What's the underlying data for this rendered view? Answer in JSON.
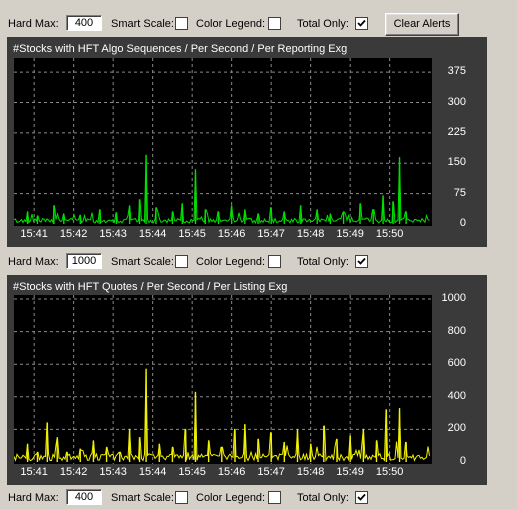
{
  "controls": {
    "hard_max_label": "Hard Max:",
    "smart_scale_label": "Smart Scale:",
    "color_legend_label": "Color Legend:",
    "total_only_label": "Total Only:",
    "clear_alerts_label": "Clear Alerts"
  },
  "rows": [
    {
      "hard_max": "400",
      "smart_scale": false,
      "color_legend": false,
      "total_only": true
    },
    {
      "hard_max": "1000",
      "smart_scale": false,
      "color_legend": false,
      "total_only": true
    },
    {
      "hard_max": "400",
      "smart_scale": false,
      "color_legend": false,
      "total_only": true
    }
  ],
  "chart_data": [
    {
      "type": "line",
      "title": "#Stocks with HFT Algo Sequences / Per Second / Per Reporting Exg",
      "color": "#00e000",
      "x_ticks": [
        "15:41",
        "15:42",
        "15:43",
        "15:44",
        "15:45",
        "15:46",
        "15:47",
        "15:48",
        "15:49",
        "15:50"
      ],
      "y_ticks": [
        0,
        75,
        150,
        225,
        300,
        375
      ],
      "ylim": [
        0,
        400
      ],
      "grid": true,
      "spikes": [
        {
          "t": "15:40:50",
          "v": 30
        },
        {
          "t": "15:41:05",
          "v": 20
        },
        {
          "t": "15:41:30",
          "v": 45
        },
        {
          "t": "15:41:45",
          "v": 25
        },
        {
          "t": "15:42:10",
          "v": 22
        },
        {
          "t": "15:42:40",
          "v": 35
        },
        {
          "t": "15:43:05",
          "v": 28
        },
        {
          "t": "15:43:25",
          "v": 45
        },
        {
          "t": "15:43:40",
          "v": 60
        },
        {
          "t": "15:43:50",
          "v": 170
        },
        {
          "t": "15:44:05",
          "v": 40
        },
        {
          "t": "15:44:30",
          "v": 30
        },
        {
          "t": "15:44:45",
          "v": 50
        },
        {
          "t": "15:45:05",
          "v": 135
        },
        {
          "t": "15:45:20",
          "v": 35
        },
        {
          "t": "15:45:40",
          "v": 30
        },
        {
          "t": "15:46:00",
          "v": 45
        },
        {
          "t": "15:46:20",
          "v": 35
        },
        {
          "t": "15:46:40",
          "v": 25
        },
        {
          "t": "15:47:00",
          "v": 40
        },
        {
          "t": "15:47:20",
          "v": 30
        },
        {
          "t": "15:47:45",
          "v": 45
        },
        {
          "t": "15:48:10",
          "v": 35
        },
        {
          "t": "15:48:30",
          "v": 25
        },
        {
          "t": "15:48:50",
          "v": 30
        },
        {
          "t": "15:49:15",
          "v": 50
        },
        {
          "t": "15:49:35",
          "v": 35
        },
        {
          "t": "15:49:50",
          "v": 70
        },
        {
          "t": "15:50:05",
          "v": 55
        },
        {
          "t": "15:50:15",
          "v": 165
        },
        {
          "t": "15:50:25",
          "v": 30
        }
      ]
    },
    {
      "type": "line",
      "title": "#Stocks with HFT Quotes / Per Second / Per Listing Exg",
      "color": "#f0f000",
      "x_ticks": [
        "15:41",
        "15:42",
        "15:43",
        "15:44",
        "15:45",
        "15:46",
        "15:47",
        "15:48",
        "15:49",
        "15:50"
      ],
      "y_ticks": [
        0,
        200,
        400,
        600,
        800,
        1000
      ],
      "ylim": [
        0,
        1000
      ],
      "grid": true,
      "spikes": [
        {
          "t": "15:40:50",
          "v": 110
        },
        {
          "t": "15:41:05",
          "v": 60
        },
        {
          "t": "15:41:20",
          "v": 240
        },
        {
          "t": "15:41:35",
          "v": 150
        },
        {
          "t": "15:41:50",
          "v": 60
        },
        {
          "t": "15:42:10",
          "v": 80
        },
        {
          "t": "15:42:30",
          "v": 130
        },
        {
          "t": "15:42:50",
          "v": 90
        },
        {
          "t": "15:43:10",
          "v": 60
        },
        {
          "t": "15:43:25",
          "v": 200
        },
        {
          "t": "15:43:40",
          "v": 150
        },
        {
          "t": "15:43:50",
          "v": 570
        },
        {
          "t": "15:44:10",
          "v": 110
        },
        {
          "t": "15:44:30",
          "v": 90
        },
        {
          "t": "15:44:50",
          "v": 200
        },
        {
          "t": "15:45:05",
          "v": 430
        },
        {
          "t": "15:45:25",
          "v": 130
        },
        {
          "t": "15:45:45",
          "v": 90
        },
        {
          "t": "15:46:05",
          "v": 200
        },
        {
          "t": "15:46:20",
          "v": 230
        },
        {
          "t": "15:46:40",
          "v": 140
        },
        {
          "t": "15:47:00",
          "v": 180
        },
        {
          "t": "15:47:20",
          "v": 120
        },
        {
          "t": "15:47:40",
          "v": 200
        },
        {
          "t": "15:48:00",
          "v": 110
        },
        {
          "t": "15:48:20",
          "v": 220
        },
        {
          "t": "15:48:40",
          "v": 140
        },
        {
          "t": "15:49:00",
          "v": 160
        },
        {
          "t": "15:49:20",
          "v": 200
        },
        {
          "t": "15:49:40",
          "v": 130
        },
        {
          "t": "15:49:55",
          "v": 320
        },
        {
          "t": "15:50:15",
          "v": 330
        },
        {
          "t": "15:50:25",
          "v": 120
        }
      ]
    }
  ]
}
